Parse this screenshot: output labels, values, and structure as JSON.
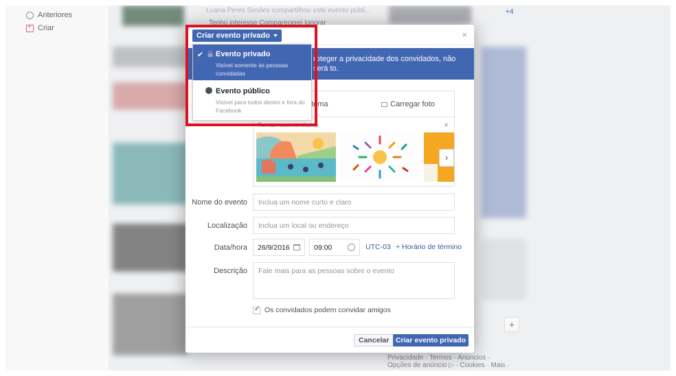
{
  "background": {
    "left_items": [
      "Anteriores",
      "Criar"
    ],
    "feed_snippet": "Luana Peres Simões compartilhou este evento públi...",
    "feed_buttons": [
      "Tenho interesse",
      "Comparecerei",
      "Ignorar"
    ],
    "right_count": "+4",
    "footer_links_1": "Privacidade · Termos · Anúncios ·",
    "footer_links_2": "Opções de anúncio ▷ · Cookies · Mais ·",
    "plus_button": "+"
  },
  "modal": {
    "dropdown_label": "Criar evento privado",
    "close": "×",
    "privacy_options": [
      {
        "title": "Evento privado",
        "description": "Visível somente às pessoas convidadas",
        "selected": true
      },
      {
        "title": "Evento público",
        "description": "Visível para todos dentro e fora do Facebook",
        "selected": false
      }
    ],
    "banner_text": "roteger a privacidade dos convidados, não será                  to.",
    "photo": {
      "tab_theme": "tema",
      "tab_upload": "Carregar foto",
      "themes_label": "Temas recomendados",
      "themes_close": "×",
      "next": "›"
    },
    "fields": {
      "name_label": "Nome do evento",
      "name_placeholder": "Inclua um nome curto e claro",
      "location_label": "Localização",
      "location_placeholder": "Inclua um local ou endereço",
      "datetime_label": "Data/hora",
      "date_value": "26/9/2016",
      "time_value": "09:00",
      "timezone": "UTC-03",
      "end_time_link": "+ Horário de término",
      "description_label": "Descrição",
      "description_placeholder": "Fale mais para as pessoas sobre o evento"
    },
    "guests_can_invite": "Os convidados podem convidar amigos",
    "cancel_label": "Cancelar",
    "create_label": "Criar evento privado"
  },
  "colors": {
    "brand": "#4267b2",
    "highlight": "#e0101e"
  }
}
